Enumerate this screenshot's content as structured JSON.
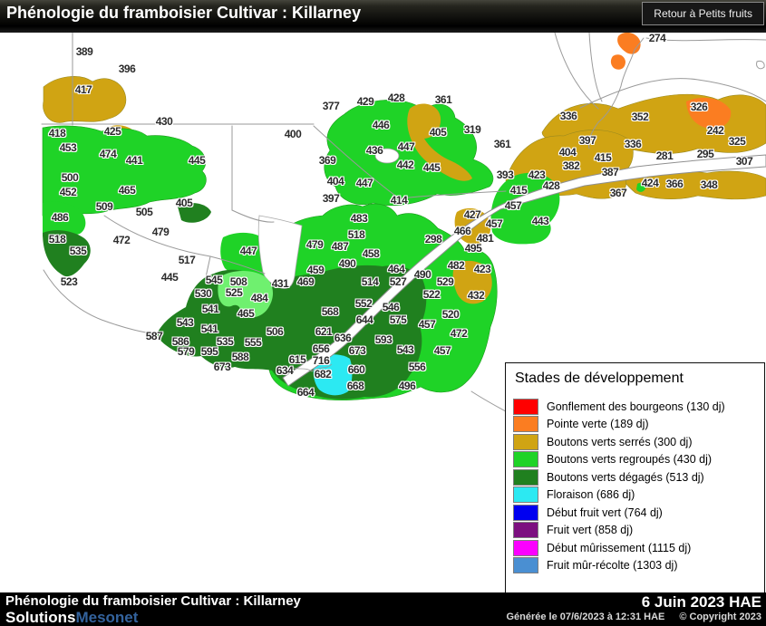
{
  "header": {
    "title": "Phénologie du framboisier Cultivar : Killarney",
    "button_label": "Retour à Petits fruits"
  },
  "legend": {
    "title": "Stades de développement",
    "items": [
      {
        "label": "Gonflement des bourgeons (130 dj)",
        "color": "#ff0000"
      },
      {
        "label": "Pointe verte (189 dj)",
        "color": "#fb7d21"
      },
      {
        "label": "Boutons verts serrés (300 dj)",
        "color": "#d0a413"
      },
      {
        "label": "Boutons verts regroupés (430 dj)",
        "color": "#1fd327"
      },
      {
        "label": "Boutons verts dégagés (513 dj)",
        "color": "#20801f"
      },
      {
        "label": "Floraison (686 dj)",
        "color": "#2ce9f2"
      },
      {
        "label": "Début fruit vert (764 dj)",
        "color": "#0000f0"
      },
      {
        "label": "Fruit vert (858 dj)",
        "color": "#7c0f80"
      },
      {
        "label": "Début mûrissement (1115 dj)",
        "color": "#fb00ff"
      },
      {
        "label": "Fruit mûr-récolte (1303 dj)",
        "color": "#4a8fd2"
      }
    ]
  },
  "footer": {
    "title": "Phénologie du framboisier Cultivar : Killarney",
    "date": "6 Juin 2023 HAE",
    "generated": "Générée le 07/6/2023 à 12:31 HAE",
    "copyright": "© Copyright 2023",
    "brand_solutions": "Solutions",
    "brand_mesonet": "Mesonet"
  },
  "map": {
    "labels": [
      [
        389,
        93,
        57
      ],
      [
        396,
        140,
        76
      ],
      [
        417,
        92,
        99
      ],
      [
        430,
        181,
        134
      ],
      [
        418,
        63,
        147
      ],
      [
        425,
        124,
        145
      ],
      [
        453,
        75,
        163
      ],
      [
        474,
        119,
        170
      ],
      [
        441,
        148,
        177
      ],
      [
        445,
        217,
        177
      ],
      [
        500,
        77,
        196
      ],
      [
        452,
        75,
        212
      ],
      [
        465,
        140,
        210
      ],
      [
        509,
        115,
        228
      ],
      [
        505,
        159,
        234
      ],
      [
        405,
        203,
        224
      ],
      [
        486,
        66,
        240
      ],
      [
        518,
        63,
        264
      ],
      [
        535,
        86,
        277
      ],
      [
        523,
        76,
        311
      ],
      [
        472,
        134,
        265
      ],
      [
        479,
        177,
        256
      ],
      [
        517,
        206,
        287
      ],
      [
        445,
        187,
        306
      ],
      [
        447,
        274,
        277
      ],
      [
        377,
        365,
        117
      ],
      [
        429,
        403,
        112
      ],
      [
        428,
        437,
        108
      ],
      [
        361,
        489,
        110
      ],
      [
        446,
        420,
        138
      ],
      [
        405,
        483,
        146
      ],
      [
        319,
        521,
        143
      ],
      [
        436,
        413,
        166
      ],
      [
        447,
        448,
        162
      ],
      [
        442,
        447,
        182
      ],
      [
        445,
        476,
        185
      ],
      [
        400,
        323,
        148
      ],
      [
        369,
        361,
        177
      ],
      [
        404,
        370,
        200
      ],
      [
        447,
        402,
        202
      ],
      [
        397,
        365,
        219
      ],
      [
        414,
        440,
        221
      ],
      [
        274,
        725,
        42
      ],
      [
        336,
        627,
        128
      ],
      [
        352,
        706,
        129
      ],
      [
        326,
        771,
        118
      ],
      [
        242,
        789,
        144
      ],
      [
        325,
        813,
        156
      ],
      [
        336,
        698,
        159
      ],
      [
        281,
        733,
        172
      ],
      [
        295,
        778,
        170
      ],
      [
        307,
        821,
        178
      ],
      [
        424,
        717,
        202
      ],
      [
        366,
        744,
        203
      ],
      [
        348,
        782,
        204
      ],
      [
        361,
        554,
        159
      ],
      [
        397,
        648,
        155
      ],
      [
        404,
        626,
        168
      ],
      [
        415,
        665,
        174
      ],
      [
        382,
        630,
        183
      ],
      [
        387,
        673,
        190
      ],
      [
        393,
        557,
        193
      ],
      [
        423,
        592,
        193
      ],
      [
        428,
        608,
        205
      ],
      [
        415,
        572,
        210
      ],
      [
        367,
        682,
        213
      ],
      [
        457,
        566,
        227
      ],
      [
        443,
        596,
        244
      ],
      [
        427,
        521,
        237
      ],
      [
        457,
        545,
        247
      ],
      [
        466,
        510,
        255
      ],
      [
        481,
        535,
        263
      ],
      [
        495,
        522,
        274
      ],
      [
        298,
        478,
        264
      ],
      [
        483,
        396,
        241
      ],
      [
        518,
        393,
        259
      ],
      [
        479,
        347,
        270
      ],
      [
        487,
        375,
        272
      ],
      [
        458,
        409,
        280
      ],
      [
        490,
        383,
        291
      ],
      [
        459,
        348,
        298
      ],
      [
        469,
        337,
        311
      ],
      [
        431,
        309,
        313
      ],
      [
        464,
        437,
        297
      ],
      [
        514,
        408,
        311
      ],
      [
        527,
        439,
        311
      ],
      [
        490,
        466,
        303
      ],
      [
        529,
        491,
        311
      ],
      [
        522,
        476,
        325
      ],
      [
        482,
        503,
        293
      ],
      [
        423,
        532,
        297
      ],
      [
        432,
        525,
        326
      ],
      [
        552,
        401,
        335
      ],
      [
        546,
        431,
        339
      ],
      [
        568,
        364,
        344
      ],
      [
        644,
        402,
        353
      ],
      [
        575,
        439,
        353
      ],
      [
        520,
        497,
        347
      ],
      [
        457,
        471,
        358
      ],
      [
        472,
        506,
        368
      ],
      [
        506,
        303,
        366
      ],
      [
        621,
        357,
        366
      ],
      [
        636,
        378,
        373
      ],
      [
        593,
        423,
        375
      ],
      [
        656,
        354,
        385
      ],
      [
        673,
        394,
        387
      ],
      [
        543,
        447,
        386
      ],
      [
        457,
        488,
        387
      ],
      [
        615,
        328,
        397
      ],
      [
        716,
        354,
        398
      ],
      [
        634,
        314,
        409
      ],
      [
        682,
        356,
        413
      ],
      [
        660,
        393,
        408
      ],
      [
        556,
        460,
        405
      ],
      [
        668,
        392,
        426
      ],
      [
        496,
        449,
        426
      ],
      [
        664,
        337,
        433
      ],
      [
        545,
        236,
        309
      ],
      [
        508,
        263,
        311
      ],
      [
        530,
        224,
        324
      ],
      [
        525,
        258,
        323
      ],
      [
        484,
        286,
        329
      ],
      [
        541,
        232,
        341
      ],
      [
        465,
        271,
        346
      ],
      [
        543,
        204,
        356
      ],
      [
        541,
        231,
        363
      ],
      [
        587,
        170,
        371
      ],
      [
        586,
        199,
        377
      ],
      [
        535,
        248,
        377
      ],
      [
        555,
        279,
        378
      ],
      [
        579,
        205,
        388
      ],
      [
        595,
        231,
        388
      ],
      [
        588,
        265,
        394
      ],
      [
        673,
        245,
        405
      ]
    ]
  }
}
